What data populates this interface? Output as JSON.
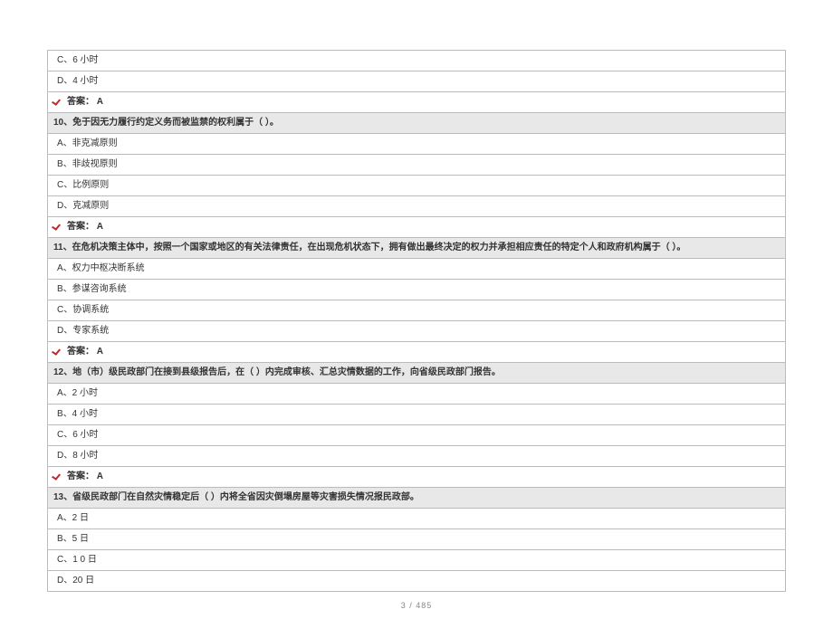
{
  "blocks": [
    {
      "type": "option",
      "text": "C、6 小时"
    },
    {
      "type": "option",
      "text": "D、4 小时"
    },
    {
      "type": "answer",
      "text": "答案：  A"
    },
    {
      "type": "question",
      "text": "10、免于因无力履行约定义务而被监禁的权利属于（            ）。"
    },
    {
      "type": "option",
      "text": "A、非克减原则"
    },
    {
      "type": "option",
      "text": "B、非歧视原则"
    },
    {
      "type": "option",
      "text": "C、比例原则"
    },
    {
      "type": "option",
      "text": "D、克减原则"
    },
    {
      "type": "answer",
      "text": "答案：  A"
    },
    {
      "type": "question",
      "text": "11、在危机决策主体中，按照一个国家或地区的有关法律责任，在出现危机状态下，拥有做出最终决定的权力并承担相应责任的特定个人和政府机构属于（                            ）。"
    },
    {
      "type": "option",
      "text": "A、权力中枢决断系统"
    },
    {
      "type": "option",
      "text": "B、参谋咨询系统"
    },
    {
      "type": "option",
      "text": "C、协调系统"
    },
    {
      "type": "option",
      "text": "D、专家系统"
    },
    {
      "type": "answer",
      "text": "答案：  A"
    },
    {
      "type": "question",
      "text": "12、地（市）级民政部门在接到县级报告后，在（            ）内完成审核、汇总灾情数据的工作，向省级民政部门报告。"
    },
    {
      "type": "option",
      "text": "A、2 小时"
    },
    {
      "type": "option",
      "text": "B、4 小时"
    },
    {
      "type": "option",
      "text": "C、6 小时"
    },
    {
      "type": "option",
      "text": "D、8 小时"
    },
    {
      "type": "answer",
      "text": "答案：  A"
    },
    {
      "type": "question",
      "text": "13、省级民政部门在自然灾情稳定后（            ）内将全省因灾倒塌房屋等灾害损失情况报民政部。"
    },
    {
      "type": "option",
      "text": "A、2 日"
    },
    {
      "type": "option",
      "text": "B、5 日"
    },
    {
      "type": "option",
      "text": "C、1 0 日"
    },
    {
      "type": "option",
      "text": "D、20 日"
    }
  ],
  "footer": "3  /  485"
}
